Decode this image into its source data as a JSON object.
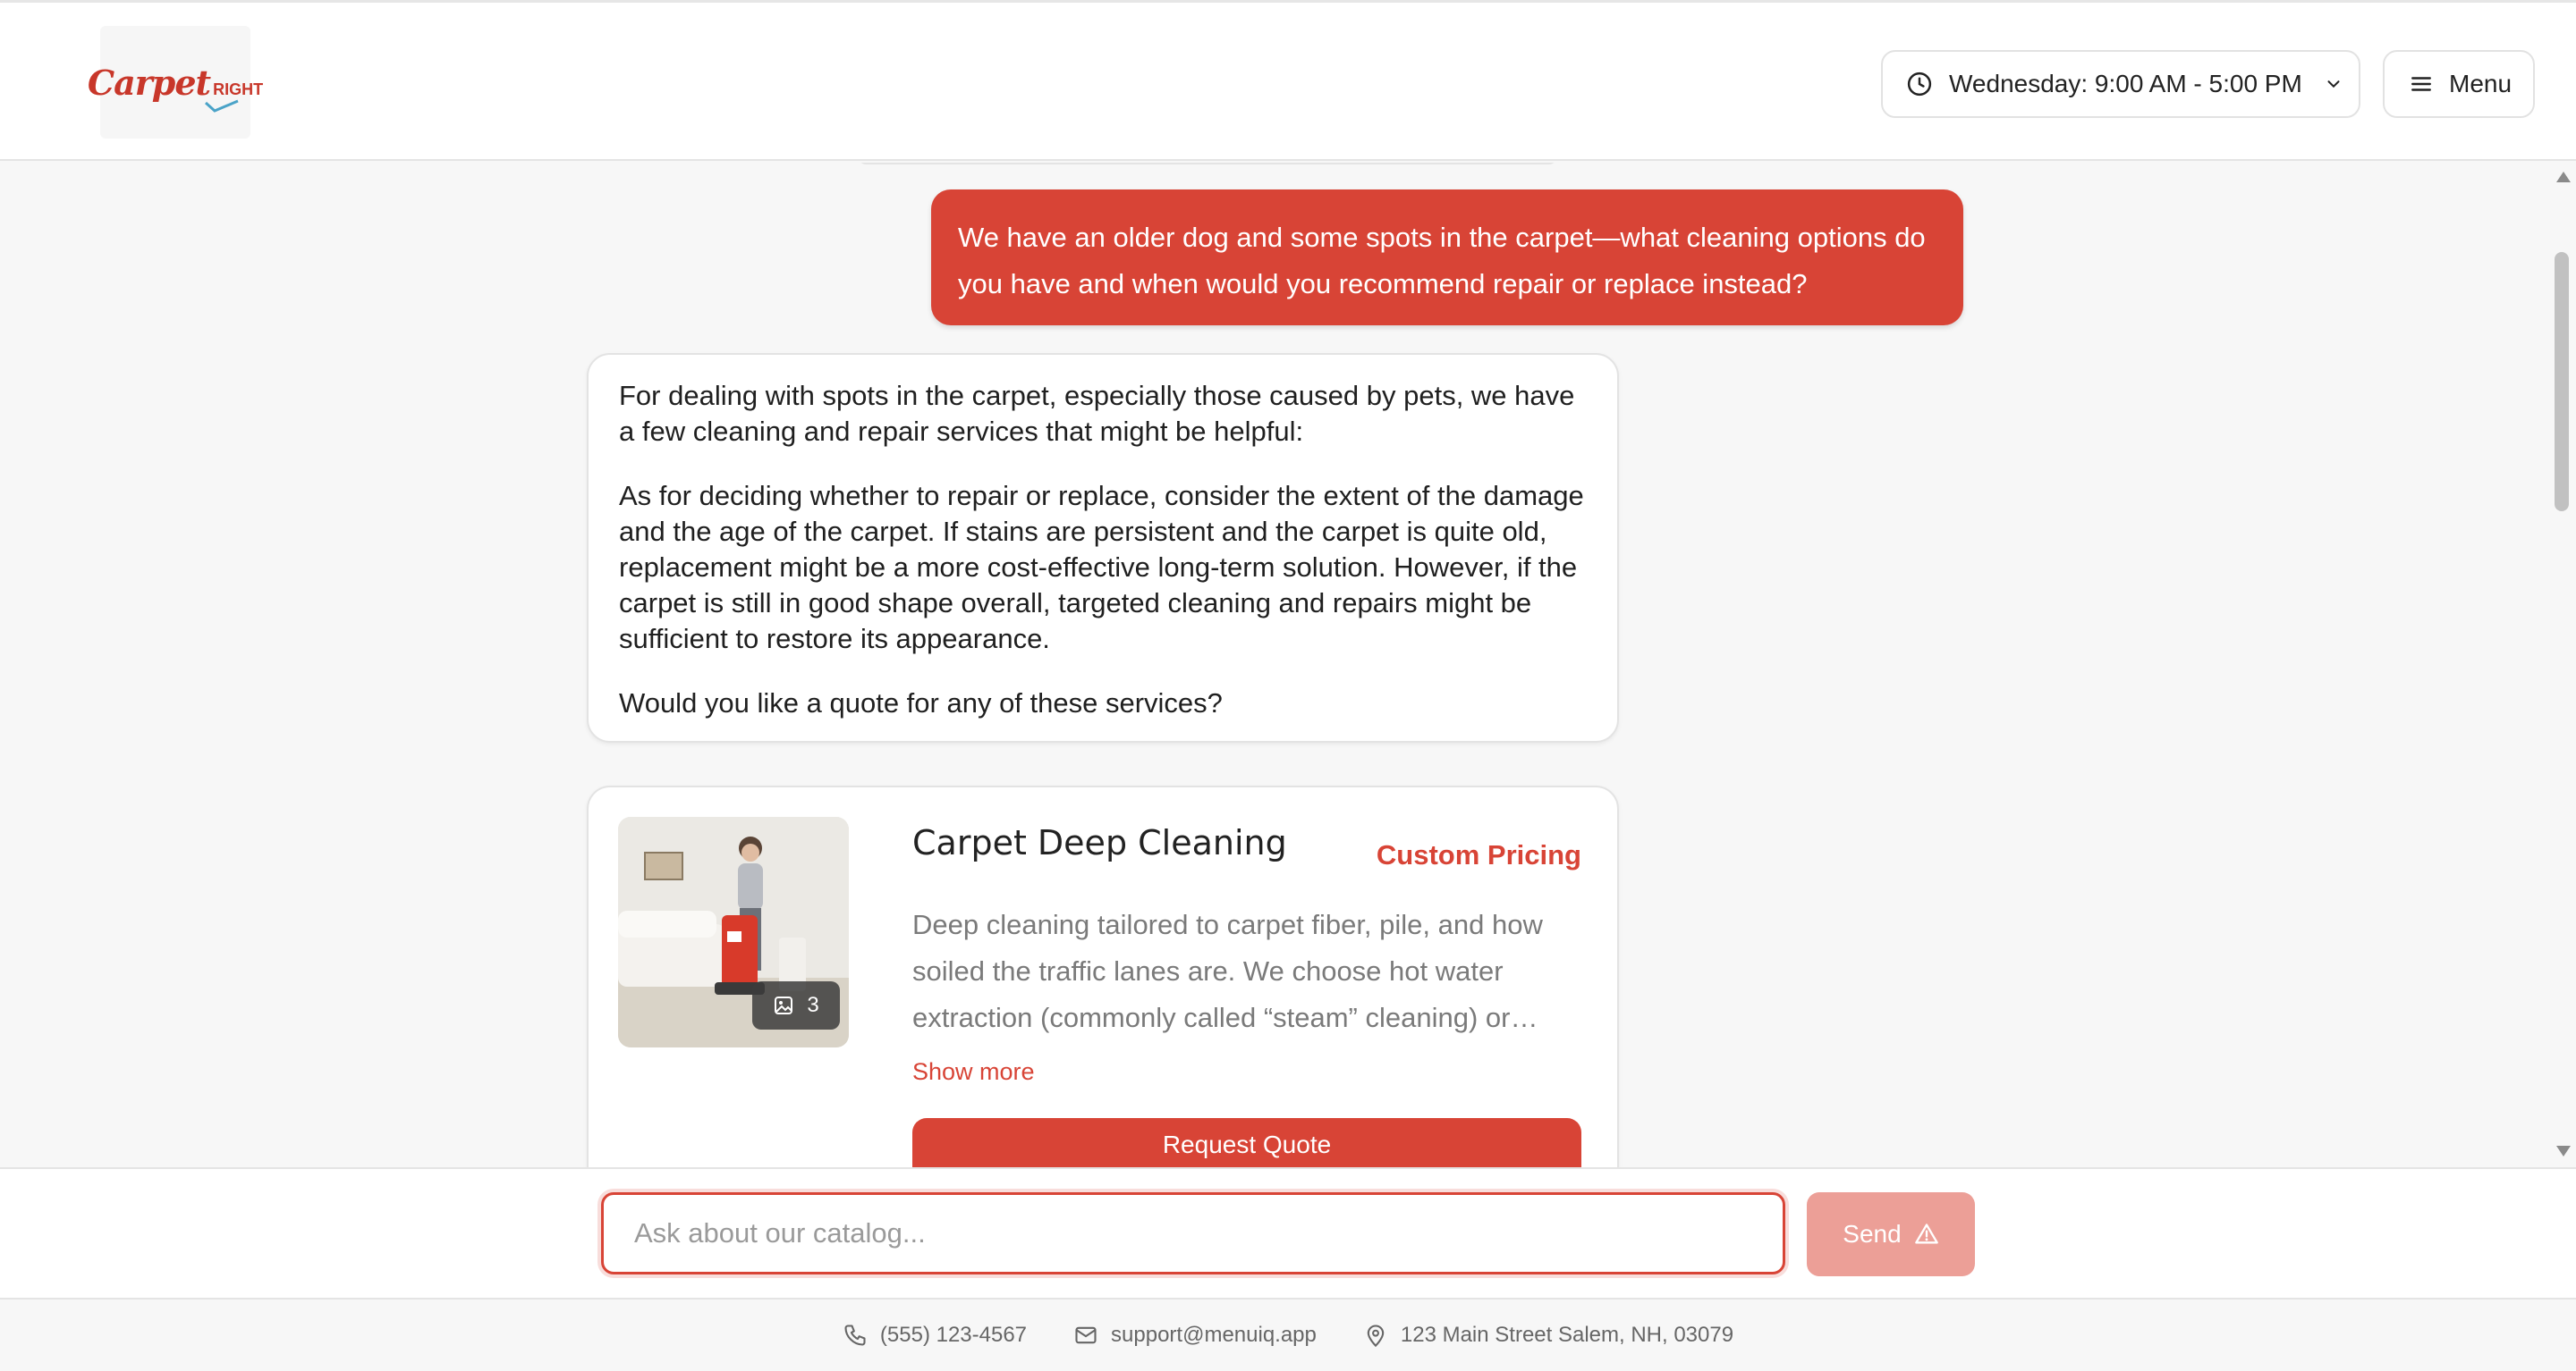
{
  "header": {
    "logo_text_main": "Carpet",
    "logo_text_sub": "RIGHT",
    "hours_label": "Wednesday: 9:00 AM - 5:00 PM",
    "menu_label": "Menu"
  },
  "chat": {
    "user_message": "We have an older dog and some spots in the carpet—what cleaning options do you have and when would you recommend repair or replace instead?",
    "bot_paragraphs": [
      "For dealing with spots in the carpet, especially those caused by pets, we have a few cleaning and repair services that might be helpful:",
      "As for deciding whether to repair or replace, consider the extent of the damage and the age of the carpet. If stains are persistent and the carpet is quite old, replacement might be a more cost-effective long-term solution. However, if the carpet is still in good shape overall, targeted cleaning and repairs might be sufficient to restore its appearance.",
      "Would you like a quote for any of these services?"
    ],
    "product": {
      "title": "Carpet Deep Cleaning",
      "price": "Custom Pricing",
      "description": "Deep cleaning tailored to carpet fiber, pile, and how soiled the traffic lanes are. We choose hot water extraction (commonly called “steam” cleaning) or…",
      "image_count": "3",
      "show_more": "Show more",
      "cta": "Request Quote"
    }
  },
  "input": {
    "placeholder": "Ask about our catalog...",
    "value": "",
    "send_label": "Send"
  },
  "footer": {
    "phone": "(555) 123-4567",
    "email": "support@menuiq.app",
    "address": "123 Main Street Salem, NH, 03079"
  },
  "colors": {
    "accent": "#d84436",
    "send_disabled": "#ec9f97"
  }
}
